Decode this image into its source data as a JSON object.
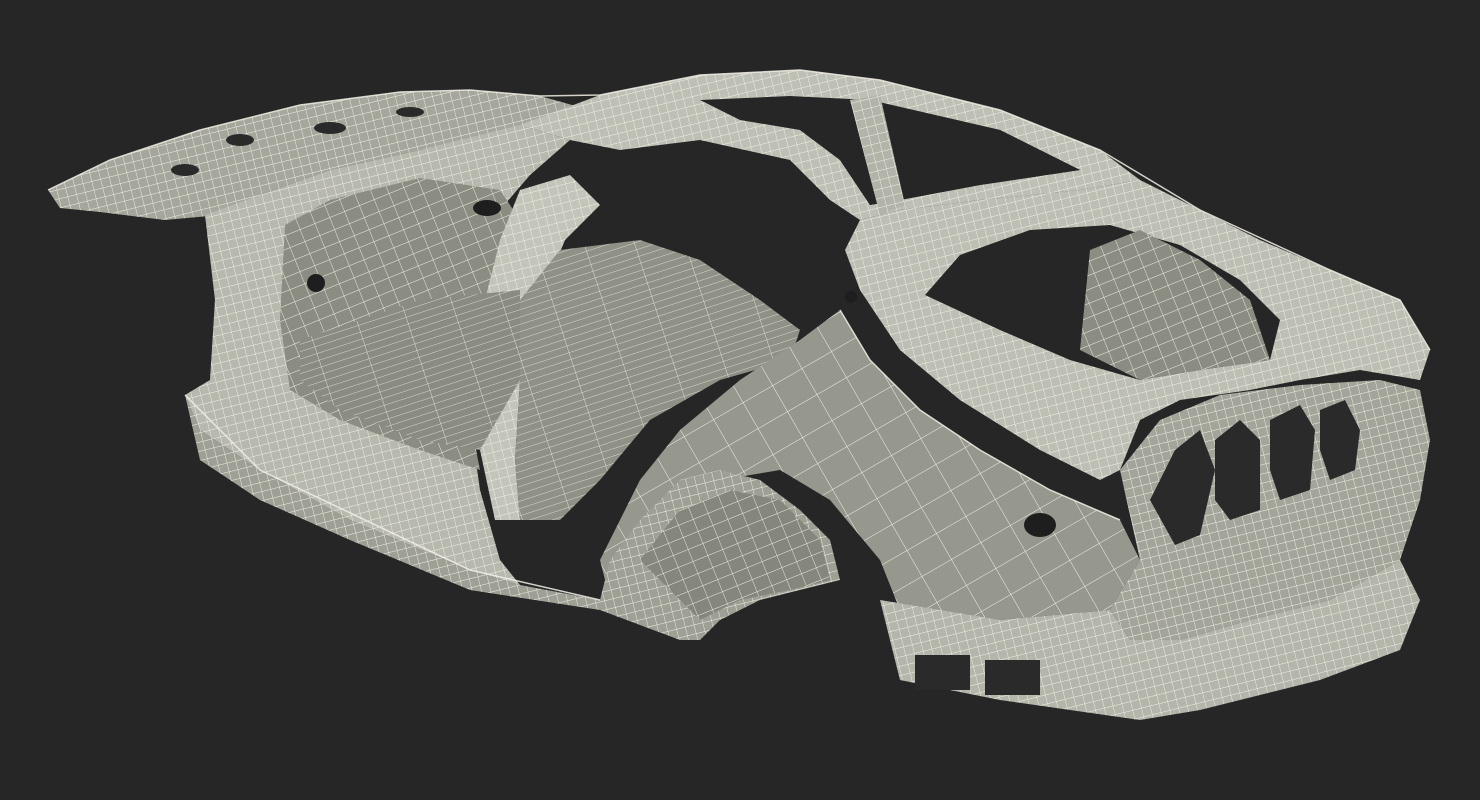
{
  "scene": {
    "background": "#262626",
    "subject": "car-body-in-white-wireframe",
    "colors": {
      "surface_light": "#c9c9be",
      "surface_mid": "#a6a79c",
      "surface_dark": "#75766c",
      "wire": "#f2f0e6",
      "hole": "#1e1e1e"
    }
  }
}
